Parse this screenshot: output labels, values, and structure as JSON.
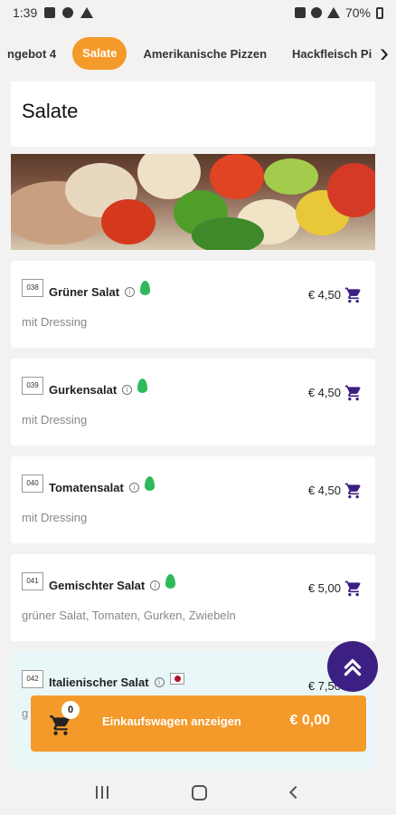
{
  "status_bar": {
    "time": "1:39",
    "battery": "70%",
    "left_icons": [
      "image-icon",
      "account-icon",
      "warning-icon"
    ],
    "right_icons": [
      "mute-icon",
      "wifi-icon",
      "signal-icon",
      "battery-icon"
    ]
  },
  "tabs": {
    "items": [
      {
        "label": "ngebot 4",
        "active": false
      },
      {
        "label": "Salate",
        "active": true
      },
      {
        "label": "Amerikanische Pizzen",
        "active": false
      },
      {
        "label": "Hackfleisch Pi",
        "active": false
      }
    ],
    "arrow_icon": "chevron-right-icon"
  },
  "section": {
    "title": "Salate"
  },
  "items": [
    {
      "code": "038",
      "name": "Grüner Salat",
      "price": "€ 4,50",
      "desc": "mit Dressing",
      "badge": "leaf-icon"
    },
    {
      "code": "039",
      "name": "Gurkensalat",
      "price": "€ 4,50",
      "desc": "mit Dressing",
      "badge": "leaf-icon"
    },
    {
      "code": "040",
      "name": "Tomatensalat",
      "price": "€ 4,50",
      "desc": "mit Dressing",
      "badge": "leaf-icon"
    },
    {
      "code": "041",
      "name": "Gemischter Salat",
      "price": "€ 5,00",
      "desc": "grüner Salat, Tomaten, Gurken, Zwiebeln",
      "badge": "leaf-icon"
    },
    {
      "code": "042",
      "name": "Italienischer Salat",
      "price": "€ 7,50",
      "desc": "g",
      "badge": "flag-icon"
    }
  ],
  "cart": {
    "count": "0",
    "label": "Einkaufswagen anzeigen",
    "total": "€ 0,00"
  },
  "colors": {
    "accent": "#f49a2a",
    "primary": "#3b1f83",
    "veg": "#2fb95a"
  }
}
